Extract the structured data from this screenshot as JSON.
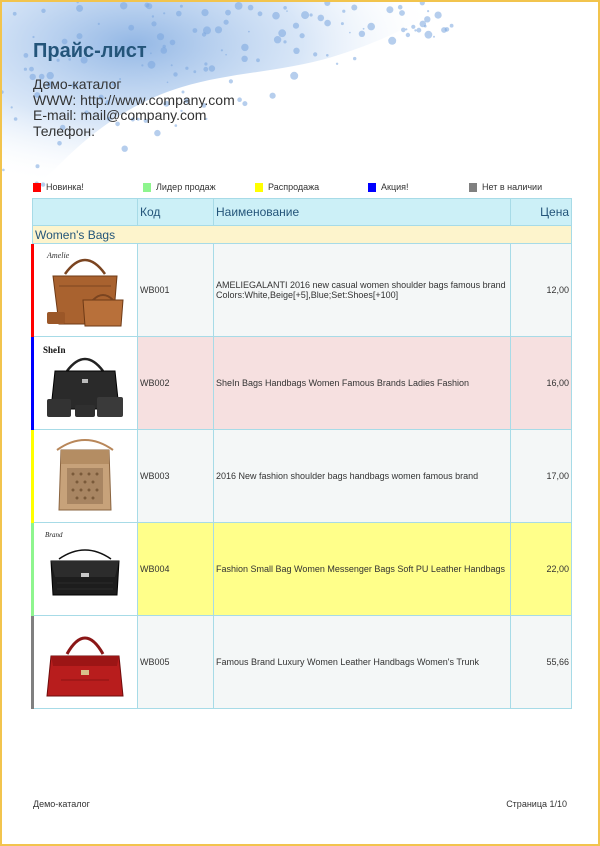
{
  "header": {
    "title": "Прайс-лист",
    "company_name": "Демо-каталог",
    "www": "WWW: http://www.company.com",
    "email": "E-mail: mail@company.com",
    "phone": "Телефон:"
  },
  "legend": [
    {
      "label": "Новинка!",
      "color": "#ff0000"
    },
    {
      "label": "Лидер продаж",
      "color": "#8ef58e"
    },
    {
      "label": "Распродажа",
      "color": "#ffff00"
    },
    {
      "label": "Акция!",
      "color": "#0000ff"
    },
    {
      "label": "Нет в наличии",
      "color": "#808080"
    }
  ],
  "table": {
    "col_code": "Код",
    "col_name": "Наименование",
    "col_price": "Цена",
    "group": "Women's Bags",
    "rows": [
      {
        "code": "WB001",
        "name1": "AMELIEGALANTI 2016 new casual women shoulder bags famous brand",
        "name2": "Colors:White,Beige[+5],Blue;Set:Shoes[+100]",
        "price": "12,00",
        "bg": "#f4f7f7",
        "marker": "#ff0000",
        "image": "brown-bag-set-image",
        "brand": "Amelie"
      },
      {
        "code": "WB002",
        "name1": "SheIn Bags Handbags Women Famous Brands Ladies Fashion",
        "name2": "",
        "price": "16,00",
        "bg": "#f6e0e0",
        "marker": "#0000ff",
        "image": "black-bag-set-image",
        "brand": "SheIn"
      },
      {
        "code": "WB003",
        "name1": "2016 New fashion shoulder bags handbags women famous brand",
        "name2": "",
        "price": "17,00",
        "bg": "#f4f7f7",
        "marker": "#ffff00",
        "image": "tan-shoulder-bag-image",
        "brand": ""
      },
      {
        "code": "WB004",
        "name1": "Fashion Small Bag Women Messenger Bags Soft PU Leather Handbags",
        "name2": "",
        "price": "22,00",
        "bg": "#ffff8a",
        "marker": "#8ef58e",
        "image": "black-messenger-bag-image",
        "brand": "Brand"
      },
      {
        "code": "WB005",
        "name1": "Famous Brand Luxury Women Leather Handbags Women's Trunk",
        "name2": "",
        "price": "55,66",
        "bg": "#f4f7f7",
        "marker": "#808080",
        "image": "red-handbag-image",
        "brand": ""
      }
    ]
  },
  "footer": {
    "left": "Демо-каталог",
    "right": "Страница 1/10"
  }
}
